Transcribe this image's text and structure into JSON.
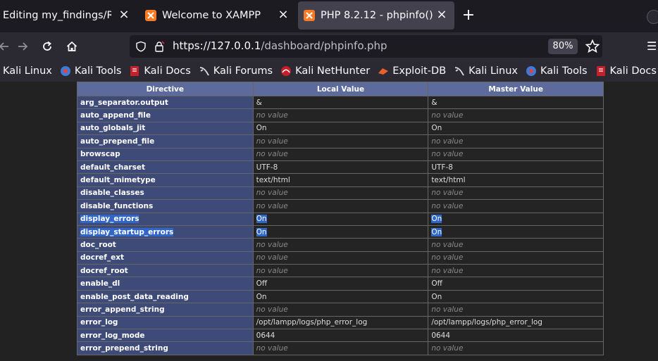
{
  "tabs": [
    {
      "title": "Editing my_findings/READ",
      "icon": "edit-page-icon",
      "active": false
    },
    {
      "title": "Welcome to XAMPP",
      "icon": "xampp-icon",
      "active": false
    },
    {
      "title": "PHP 8.2.12 - phpinfo()",
      "icon": "xampp-icon",
      "active": true
    }
  ],
  "url": {
    "scheme": "https://",
    "host": "127.0.0.1",
    "path": "/dashboard/phpinfo.php"
  },
  "zoom": "80%",
  "bookmarks": [
    {
      "label": "Kali Linux",
      "icon": "kali-dragon-icon"
    },
    {
      "label": "Kali Tools",
      "icon": "kali-tools-icon"
    },
    {
      "label": "Kali Docs",
      "icon": "kali-docs-icon"
    },
    {
      "label": "Kali Forums",
      "icon": "kali-dragon-icon"
    },
    {
      "label": "Kali NetHunter",
      "icon": "nethunter-icon"
    },
    {
      "label": "Exploit-DB",
      "icon": "exploitdb-icon"
    },
    {
      "label": "Kali Linux",
      "icon": "kali-dragon-icon"
    },
    {
      "label": "Kali Tools",
      "icon": "kali-tools-icon"
    },
    {
      "label": "Kali Docs",
      "icon": "kali-docs-icon"
    }
  ],
  "table": {
    "headers": [
      "Directive",
      "Local Value",
      "Master Value"
    ],
    "rows": [
      {
        "directive": "arg_separator.output",
        "local": "&",
        "master": "&"
      },
      {
        "directive": "auto_append_file",
        "local": "no value",
        "master": "no value",
        "novalue": true
      },
      {
        "directive": "auto_globals_jit",
        "local": "On",
        "master": "On"
      },
      {
        "directive": "auto_prepend_file",
        "local": "no value",
        "master": "no value",
        "novalue": true
      },
      {
        "directive": "browscap",
        "local": "no value",
        "master": "no value",
        "novalue": true
      },
      {
        "directive": "default_charset",
        "local": "UTF-8",
        "master": "UTF-8"
      },
      {
        "directive": "default_mimetype",
        "local": "text/html",
        "master": "text/html"
      },
      {
        "directive": "disable_classes",
        "local": "no value",
        "master": "no value",
        "novalue": true
      },
      {
        "directive": "disable_functions",
        "local": "no value",
        "master": "no value",
        "novalue": true
      },
      {
        "directive": "display_errors",
        "local": "On",
        "master": "On",
        "selected": true
      },
      {
        "directive": "display_startup_errors",
        "local": "On",
        "master": "On",
        "selected": true
      },
      {
        "directive": "doc_root",
        "local": "no value",
        "master": "no value",
        "novalue": true
      },
      {
        "directive": "docref_ext",
        "local": "no value",
        "master": "no value",
        "novalue": true
      },
      {
        "directive": "docref_root",
        "local": "no value",
        "master": "no value",
        "novalue": true
      },
      {
        "directive": "enable_dl",
        "local": "Off",
        "master": "Off"
      },
      {
        "directive": "enable_post_data_reading",
        "local": "On",
        "master": "On"
      },
      {
        "directive": "error_append_string",
        "local": "no value",
        "master": "no value",
        "novalue": true
      },
      {
        "directive": "error_log",
        "local": "/opt/lampp/logs/php_error_log",
        "master": "/opt/lampp/logs/php_error_log"
      },
      {
        "directive": "error_log_mode",
        "local": "0644",
        "master": "0644"
      },
      {
        "directive": "error_prepend_string",
        "local": "no value",
        "master": "no value",
        "novalue": true
      }
    ]
  },
  "colors": {
    "header_bg": "#5d6b9c",
    "directive_bg": "#3e4a78",
    "value_bg": "#242424",
    "selection": "#2f66c8"
  }
}
